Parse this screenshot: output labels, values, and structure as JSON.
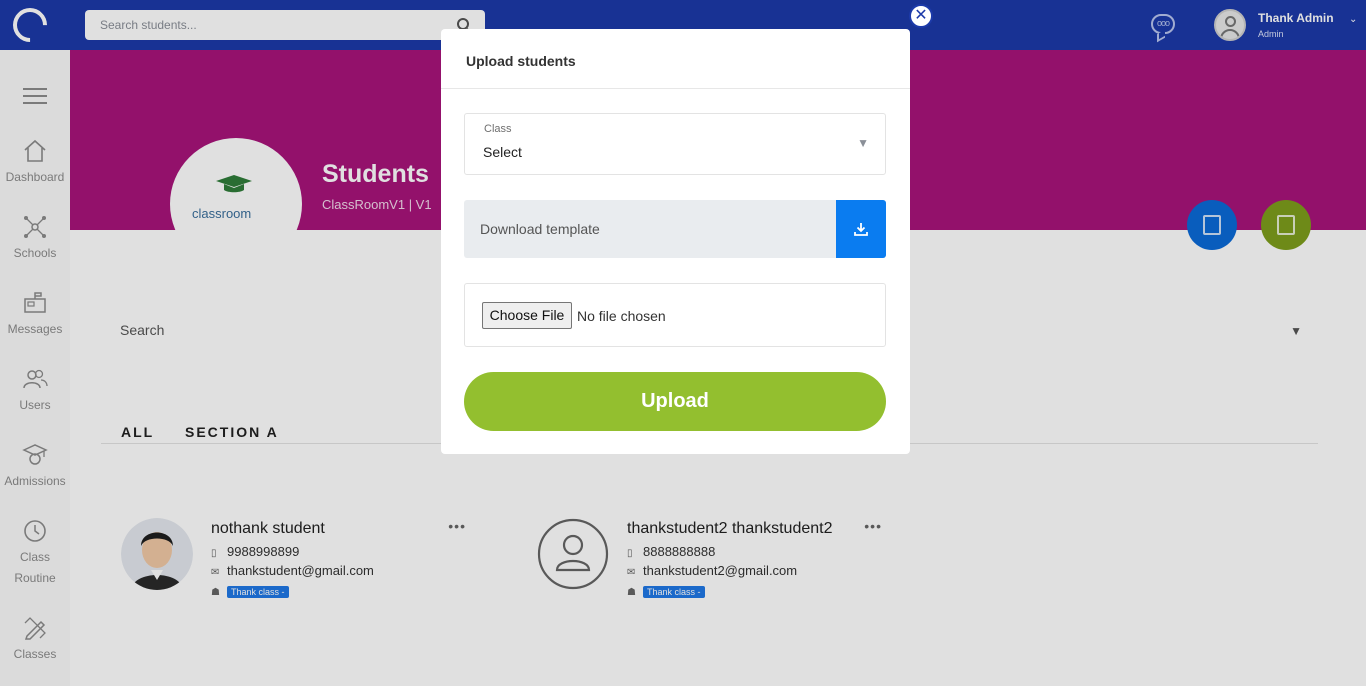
{
  "topbar": {
    "search_placeholder": "Search students...",
    "user_name": "Thank Admin",
    "user_role": "Admin"
  },
  "sidebar": {
    "items": [
      {
        "label": "Dashboard",
        "icon": "home-icon"
      },
      {
        "label": "Schools",
        "icon": "network-icon"
      },
      {
        "label": "Messages",
        "icon": "mailbox-icon"
      },
      {
        "label": "Users",
        "icon": "users-icon"
      },
      {
        "label": "Admissions",
        "icon": "graduation-icon"
      },
      {
        "label": "Class Routine",
        "icon": "clock-icon"
      },
      {
        "label": "Classes",
        "icon": "pencil-ruler-icon"
      }
    ]
  },
  "header": {
    "logo_text": "classroom",
    "title": "Students",
    "subtitle": "ClassRoomV1 | V1"
  },
  "filters": {
    "search_label": "Search"
  },
  "tabs": [
    "ALL",
    "SECTION A"
  ],
  "students": [
    {
      "name": "nothank student",
      "phone": "9988998899",
      "email": "thankstudent@gmail.com",
      "class_badge": "Thank class -"
    },
    {
      "name": "thankstudent2 thankstudent2",
      "phone": "8888888888",
      "email": "thankstudent2@gmail.com",
      "class_badge": "Thank class -"
    }
  ],
  "modal": {
    "title": "Upload students",
    "close_symbol": "✕",
    "class_label": "Class",
    "class_value": "Select",
    "download_template": "Download template",
    "choose_file": "Choose File",
    "file_status": "No file chosen",
    "upload_label": "Upload"
  },
  "colors": {
    "topbar": "#1c3aa9",
    "banner": "#a8147a",
    "upload": "#93bf2f",
    "download_btn": "#0a7cf0"
  }
}
